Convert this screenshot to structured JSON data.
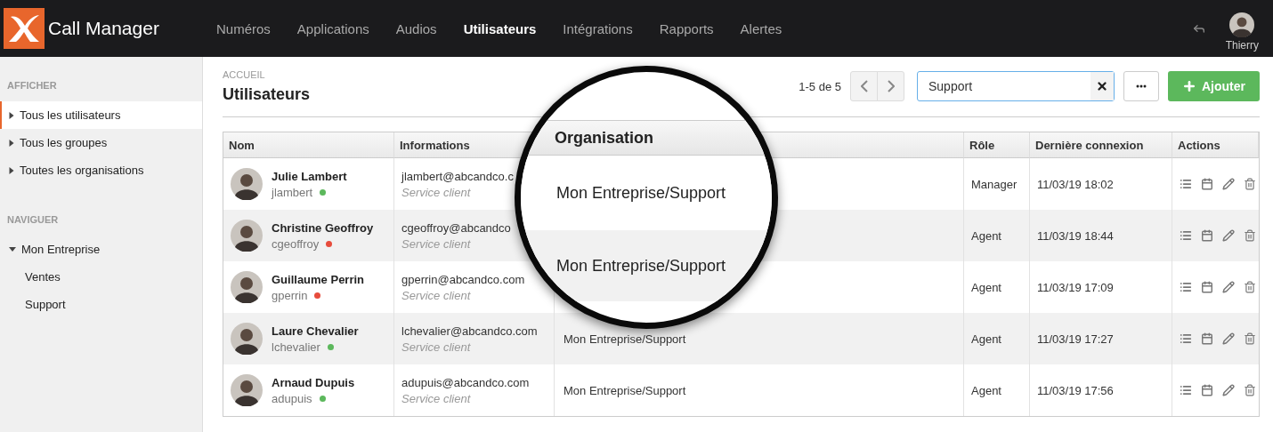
{
  "app": {
    "name": "Call Manager"
  },
  "nav": [
    {
      "label": "Numéros",
      "selected": false
    },
    {
      "label": "Applications",
      "selected": false
    },
    {
      "label": "Audios",
      "selected": false
    },
    {
      "label": "Utilisateurs",
      "selected": true
    },
    {
      "label": "Intégrations",
      "selected": false
    },
    {
      "label": "Rapports",
      "selected": false
    },
    {
      "label": "Alertes",
      "selected": false
    }
  ],
  "user": {
    "name": "Thierry"
  },
  "sidebar": {
    "sections": [
      {
        "title": "AFFICHER",
        "items": [
          {
            "label": "Tous les utilisateurs",
            "selected": true,
            "expanded": false
          },
          {
            "label": "Tous les groupes",
            "selected": false,
            "expanded": false
          },
          {
            "label": "Toutes les organisations",
            "selected": false,
            "expanded": false
          }
        ]
      },
      {
        "title": "NAVIGUER",
        "items": [
          {
            "label": "Mon Entreprise",
            "selected": false,
            "expanded": true,
            "children": [
              {
                "label": "Ventes",
                "selected": false
              },
              {
                "label": "Support",
                "selected": false
              }
            ]
          }
        ]
      }
    ]
  },
  "breadcrumb": "ACCUEIL",
  "title": "Utilisateurs",
  "pagination": "1-5 de 5",
  "search": {
    "value": "Support"
  },
  "add_button": "Ajouter",
  "table": {
    "columns": [
      "Nom",
      "Informations",
      "Rôle",
      "Dernière connexion",
      "Actions"
    ],
    "rows": [
      {
        "name": "Julie Lambert",
        "username": "jlambert",
        "color": "#5cb85c",
        "email": "jlambert@abcandco.c",
        "info": "Service client",
        "role": "Manager",
        "last_login": "11/03/19 18:02"
      },
      {
        "name": "Christine Geoffroy",
        "username": "cgeoffroy",
        "color": "#e74c3c",
        "email": "cgeoffroy@abcandco",
        "info": "Service client",
        "role": "Agent",
        "last_login": "11/03/19 18:44"
      },
      {
        "name": "Guillaume Perrin",
        "username": "gperrin",
        "color": "#e74c3c",
        "email": "gperrin@abcandco.com",
        "info": "Service client",
        "role": "Agent",
        "last_login": "11/03/19 17:09"
      },
      {
        "name": "Laure Chevalier",
        "username": "lchevalier",
        "color": "#5cb85c",
        "email": "lchevalier@abcandco.com",
        "info": "Service client",
        "organisation": "Mon Entreprise/Support",
        "role": "Agent",
        "last_login": "11/03/19 17:27"
      },
      {
        "name": "Arnaud Dupuis",
        "username": "adupuis",
        "color": "#5cb85c",
        "email": "adupuis@abcandco.com",
        "info": "Service client",
        "organisation": "Mon Entreprise/Support",
        "role": "Agent",
        "last_login": "11/03/19 17:56"
      }
    ]
  },
  "magnifier": {
    "header": "Organisation",
    "cells": [
      "Mon Entreprise/Support",
      "Mon Entreprise/Support"
    ]
  }
}
